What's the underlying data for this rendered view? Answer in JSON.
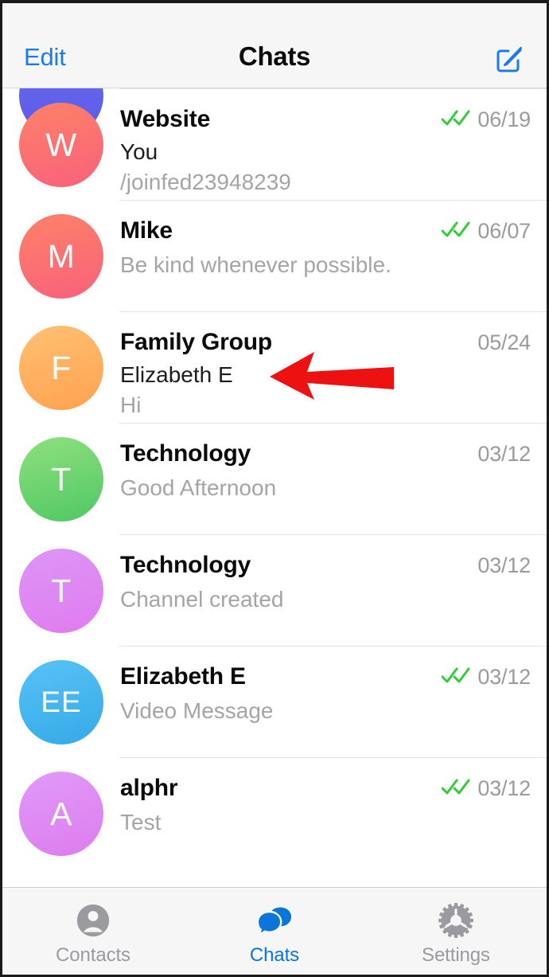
{
  "header": {
    "edit_label": "Edit",
    "title": "Chats",
    "compose_icon": "compose-icon",
    "accent_color": "#1a7ced"
  },
  "annotation": {
    "type": "arrow",
    "direction": "left",
    "color": "#ee1111",
    "points_at": "Family Group"
  },
  "chats": [
    {
      "avatar_letters": "W",
      "avatar_color_start": "#fd8268",
      "avatar_color_end": "#f9617b",
      "title": "Website",
      "sender": "You",
      "preview": "/joinfed23948239",
      "date": "06/19",
      "read_status": "double-check"
    },
    {
      "avatar_letters": "M",
      "avatar_color_start": "#fd8268",
      "avatar_color_end": "#f9617b",
      "title": "Mike",
      "sender": "",
      "preview": "Be kind whenever possible.",
      "date": "06/07",
      "read_status": "double-check"
    },
    {
      "avatar_letters": "F",
      "avatar_color_start": "#ffc073",
      "avatar_color_end": "#ffa24f",
      "title": "Family Group",
      "sender": "Elizabeth E",
      "preview": "Hi",
      "date": "05/24",
      "read_status": "none"
    },
    {
      "avatar_letters": "T",
      "avatar_color_start": "#8fe07f",
      "avatar_color_end": "#4fc862",
      "title": "Technology",
      "sender": "",
      "preview": "Good Afternoon",
      "date": "03/12",
      "read_status": "none"
    },
    {
      "avatar_letters": "T",
      "avatar_color_start": "#dc96f5",
      "avatar_color_end": "#e07bf0",
      "title": "Technology",
      "sender": "",
      "preview": "Channel created",
      "date": "03/12",
      "read_status": "none"
    },
    {
      "avatar_letters": "EE",
      "avatar_color_start": "#58c2f5",
      "avatar_color_end": "#34aae8",
      "title": "Elizabeth E",
      "sender": "",
      "preview": "Video Message",
      "date": "03/12",
      "read_status": "double-check"
    },
    {
      "avatar_letters": "A",
      "avatar_color_start": "#e09af7",
      "avatar_color_end": "#dd7cf0",
      "title": "alphr",
      "sender": "",
      "preview": "Test",
      "date": "03/12",
      "read_status": "double-check"
    }
  ],
  "tabbar": {
    "items": [
      {
        "label": "Contacts",
        "icon": "contacts-icon",
        "active": false
      },
      {
        "label": "Chats",
        "icon": "chats-icon",
        "active": true
      },
      {
        "label": "Settings",
        "icon": "settings-gear-icon",
        "active": false
      }
    ],
    "active_color": "#0b76d9",
    "inactive_color": "#9a9a9f"
  }
}
